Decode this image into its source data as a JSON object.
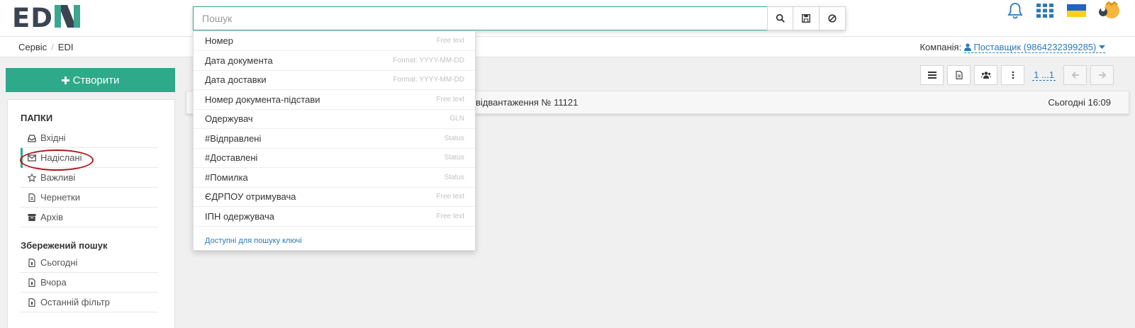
{
  "header": {
    "logo_text_a": "ED",
    "logo_text_b": "NI",
    "search_placeholder": "Пошук",
    "search_buttons": [
      "search-icon",
      "save-icon",
      "clear-icon"
    ],
    "icons": [
      "bell-icon",
      "apps-grid-icon",
      "ukraine-flag-icon",
      "user-avatar-icon"
    ]
  },
  "breadcrumb": {
    "items": [
      "Сервіс",
      "EDI"
    ],
    "separator": "/"
  },
  "company": {
    "label": "Компанія:",
    "value": "Поставщик (9864232399285)"
  },
  "sidebar": {
    "create_label": "Створити",
    "folders_title": "ПАПКИ",
    "folders": [
      {
        "label": "Вхідні",
        "icon": "inbox-icon"
      },
      {
        "label": "Надіслані",
        "icon": "envelope-icon"
      },
      {
        "label": "Важливі",
        "icon": "star-icon"
      },
      {
        "label": "Чернетки",
        "icon": "draft-icon"
      },
      {
        "label": "Архів",
        "icon": "archive-icon"
      }
    ],
    "saved_title": "Збережений пошук",
    "saved": [
      {
        "label": "Сьогодні",
        "icon": "saved-search-icon"
      },
      {
        "label": "Вчора",
        "icon": "saved-search-icon"
      },
      {
        "label": "Останній фільтр",
        "icon": "saved-search-icon"
      }
    ]
  },
  "toolbar": {
    "pager": "1 ...1",
    "buttons": [
      "list-icon",
      "document-icon",
      "users-icon",
      "more-vertical-icon",
      "arrow-left-icon",
      "arrow-right-icon"
    ]
  },
  "document": {
    "title": "відвантаження № 11121",
    "time": "Сьогодні 16:09"
  },
  "dropdown": {
    "items": [
      {
        "label": "Номер",
        "hint": "Free text"
      },
      {
        "label": "Дата документа",
        "hint": "Format: YYYY-MM-DD"
      },
      {
        "label": "Дата доставки",
        "hint": "Format: YYYY-MM-DD"
      },
      {
        "label": "Номер документа-підстави",
        "hint": "Free text"
      },
      {
        "label": "Одержувач",
        "hint": "GLN"
      },
      {
        "label": "#Відправлені",
        "hint": "Status"
      },
      {
        "label": "#Доставлені",
        "hint": "Status"
      },
      {
        "label": "#Помилка",
        "hint": "Status"
      },
      {
        "label": "ЄДРПОУ отримувача",
        "hint": "Free text"
      },
      {
        "label": "ІПН одержувача",
        "hint": "Free text"
      }
    ],
    "footer": "Доступні для пошуку ключі"
  },
  "colors": {
    "brand_green": "#2ea98a",
    "link_blue": "#2a7ab8",
    "annotation_red": "#b0181e"
  }
}
